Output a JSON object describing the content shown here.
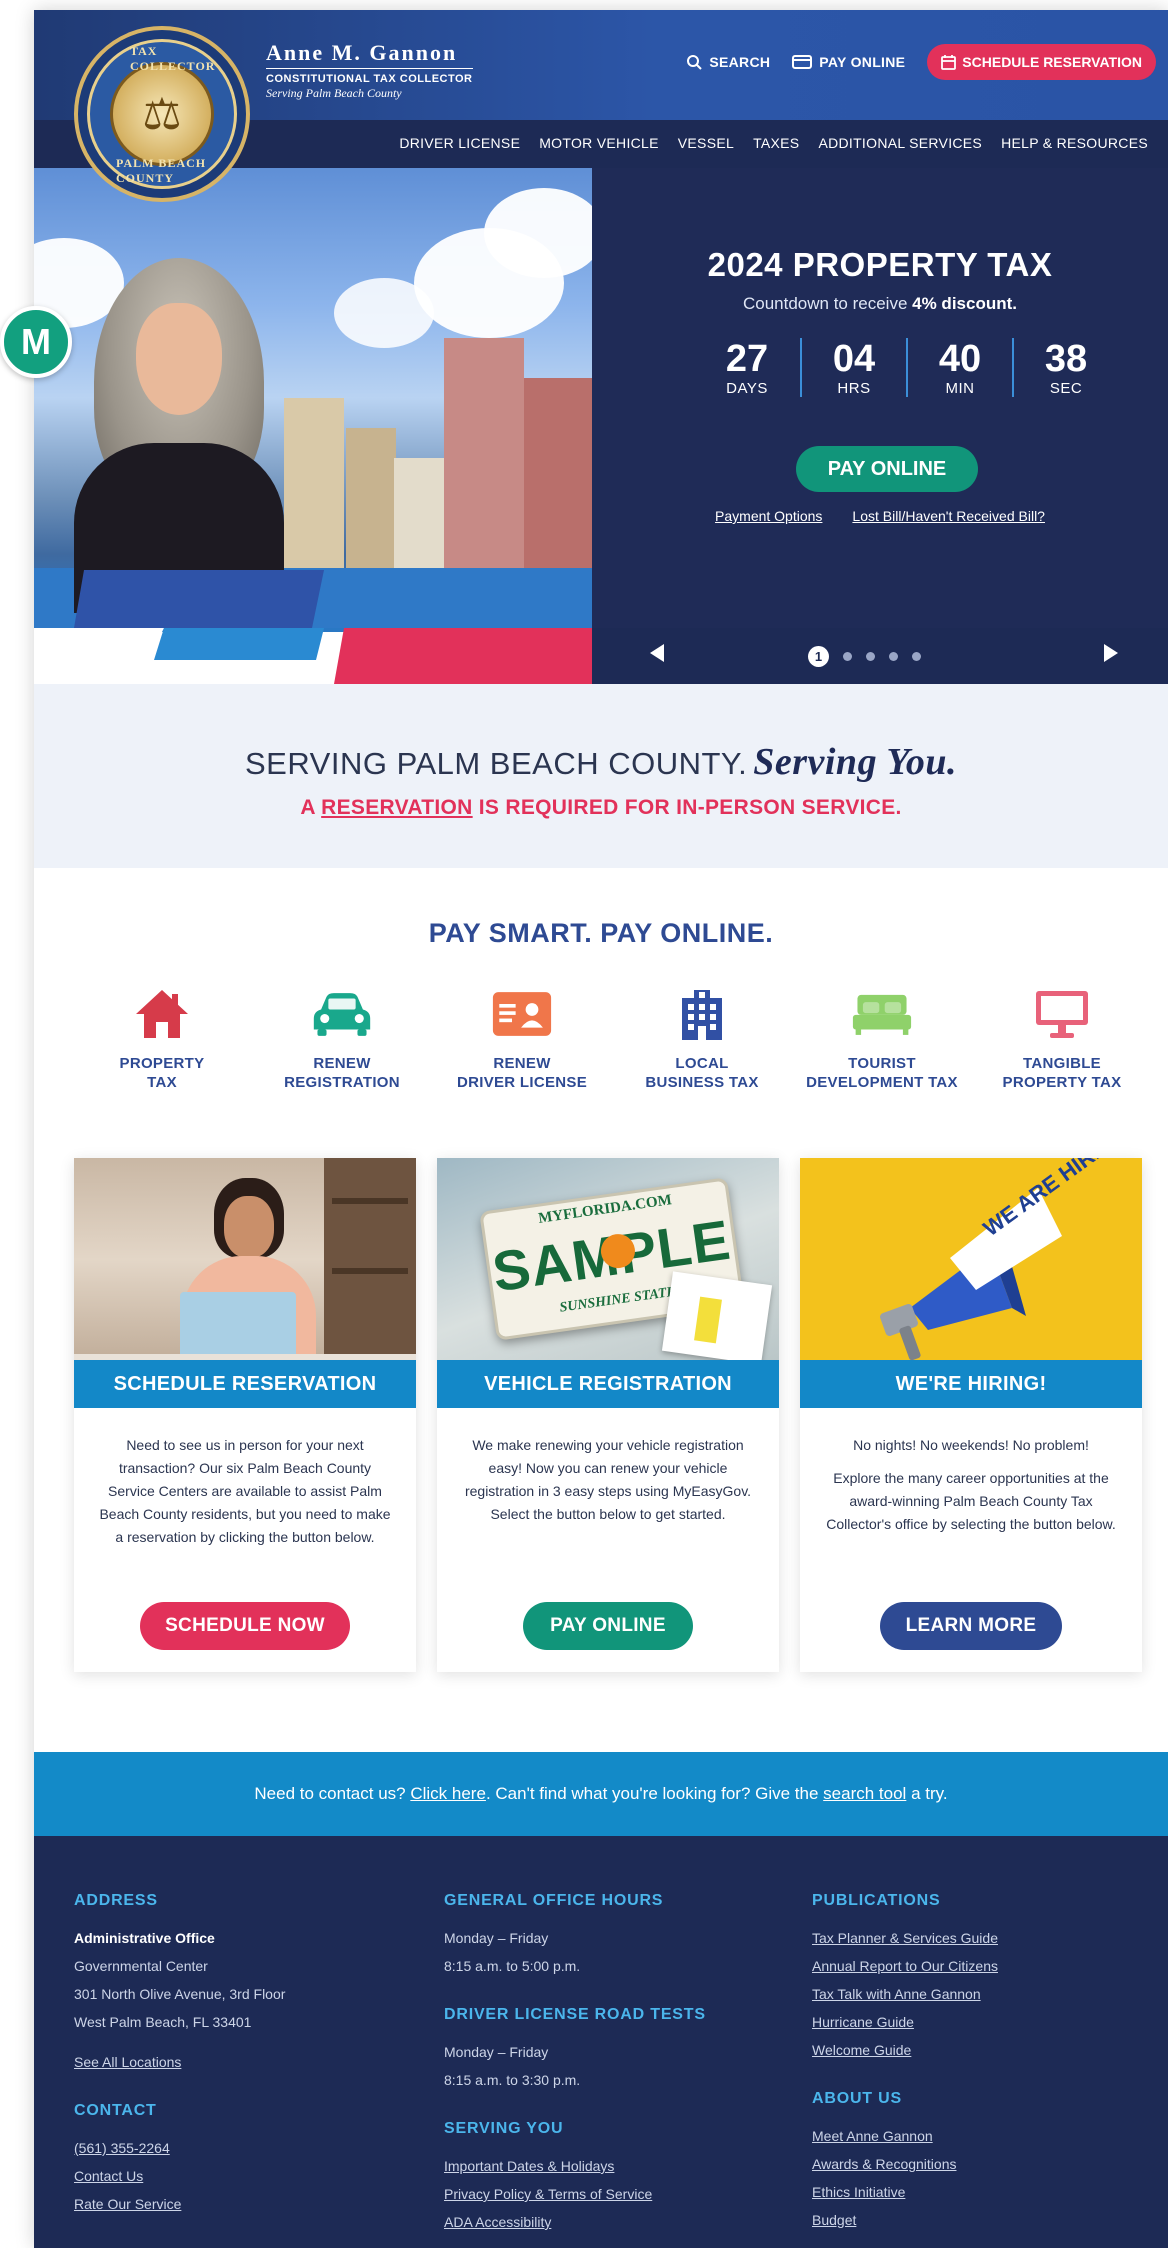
{
  "header": {
    "logo_ring_text": "TAX COLLECTOR · PALM BEACH COUNTY, FLORIDA",
    "brand_name": "Anne M. Gannon",
    "brand_role": "CONSTITUTIONAL TAX COLLECTOR",
    "brand_area": "Serving Palm Beach County",
    "search_label": "SEARCH",
    "pay_online_label": "PAY ONLINE",
    "schedule_label": "SCHEDULE RESERVATION",
    "nav": [
      "DRIVER LICENSE",
      "MOTOR VEHICLE",
      "VESSEL",
      "TAXES",
      "ADDITIONAL SERVICES",
      "HELP & RESOURCES"
    ]
  },
  "hero": {
    "title": "2024 PROPERTY TAX",
    "subtitle_prefix": "Countdown to receive ",
    "subtitle_bold": "4% discount.",
    "countdown": [
      {
        "value": "27",
        "label": "DAYS"
      },
      {
        "value": "04",
        "label": "HRS"
      },
      {
        "value": "40",
        "label": "MIN"
      },
      {
        "value": "38",
        "label": "SEC"
      }
    ],
    "button": "PAY ONLINE",
    "links": [
      "Payment Options",
      "Lost Bill/Haven't Received Bill?"
    ],
    "active_slide": "1",
    "slide_count": 5
  },
  "serving": {
    "line1": "SERVING PALM BEACH COUNTY.",
    "line1_script": "Serving You.",
    "line2_prefix": "A ",
    "line2_link": "RESERVATION",
    "line2_suffix": " IS REQUIRED FOR IN-PERSON SERVICE."
  },
  "paysmart": {
    "title": "PAY SMART. PAY ONLINE.",
    "items": [
      {
        "line1": "PROPERTY",
        "line2": "TAX",
        "icon": "house-icon",
        "color": "#d63b4a"
      },
      {
        "line1": "RENEW",
        "line2": "REGISTRATION",
        "icon": "car-icon",
        "color": "#19a88c"
      },
      {
        "line1": "RENEW",
        "line2": "DRIVER LICENSE",
        "icon": "id-card-icon",
        "color": "#f0764a"
      },
      {
        "line1": "LOCAL",
        "line2": "BUSINESS TAX",
        "icon": "building-icon",
        "color": "#3150a4"
      },
      {
        "line1": "TOURIST",
        "line2": "DEVELOPMENT TAX",
        "icon": "bed-icon",
        "color": "#8fd16a"
      },
      {
        "line1": "TANGIBLE",
        "line2": "PROPERTY TAX",
        "icon": "monitor-icon",
        "color": "#e8627a"
      }
    ]
  },
  "cards": [
    {
      "title": "SCHEDULE RESERVATION",
      "body": [
        "Need to see us in person for your next transaction? Our six Palm Beach County Service Centers are available to assist Palm Beach County residents, but you need to make a reservation by clicking the button below."
      ],
      "button": "SCHEDULE NOW",
      "button_color": "#e2315a"
    },
    {
      "title": "VEHICLE REGISTRATION",
      "plate_top": "MYFLORIDA.COM",
      "plate_main": "SAMPLE",
      "plate_bottom": "SUNSHINE STATE",
      "body": [
        "We make renewing your vehicle registration easy! Now you can renew your vehicle registration in 3 easy steps using MyEasyGov. Select the button below to get started."
      ],
      "button": "PAY ONLINE",
      "button_color": "#11957a"
    },
    {
      "title": "WE'RE HIRING!",
      "sign_text": "WE ARE HIRING",
      "body": [
        "No nights! No weekends! No problem!",
        "Explore the many career opportunities at the award-winning Palm Beach County Tax Collector's office by selecting the button below."
      ],
      "button": "LEARN MORE",
      "button_color": "#2e4a93"
    }
  ],
  "contact_band": {
    "prefix": "Need to contact us? ",
    "link1": "Click here",
    "middle": ". Can't find what you're looking for? Give the ",
    "link2": "search tool",
    "suffix": " a try."
  },
  "footer": {
    "address_heading": "ADDRESS",
    "address_title": "Administrative Office",
    "address_lines": [
      "Governmental Center",
      "301 North Olive Avenue, 3rd Floor",
      "West Palm Beach, FL 33401"
    ],
    "see_all": "See All Locations",
    "contact_heading": "CONTACT",
    "contact_links": [
      "(561) 355-2264",
      "Contact Us",
      "Rate Our Service"
    ],
    "hours_heading": "GENERAL OFFICE HOURS",
    "hours_lines": [
      "Monday – Friday",
      "8:15 a.m. to 5:00 p.m."
    ],
    "road_heading": "DRIVER LICENSE ROAD TESTS",
    "road_lines": [
      "Monday – Friday",
      "8:15 a.m. to 3:30 p.m."
    ],
    "serving_heading": "SERVING YOU",
    "serving_links": [
      "Important Dates & Holidays",
      "Privacy Policy & Terms of Service",
      "ADA Accessibility"
    ],
    "pub_heading": "PUBLICATIONS",
    "pub_links": [
      "Tax Planner & Services Guide",
      "Annual Report to Our Citizens",
      "Tax Talk with Anne Gannon",
      "Hurricane Guide",
      "Welcome Guide"
    ],
    "about_heading": "ABOUT US",
    "about_links": [
      "Meet Anne Gannon",
      "Awards & Recognitions",
      "Ethics Initiative",
      "Budget"
    ]
  },
  "avatar_letter": "M"
}
